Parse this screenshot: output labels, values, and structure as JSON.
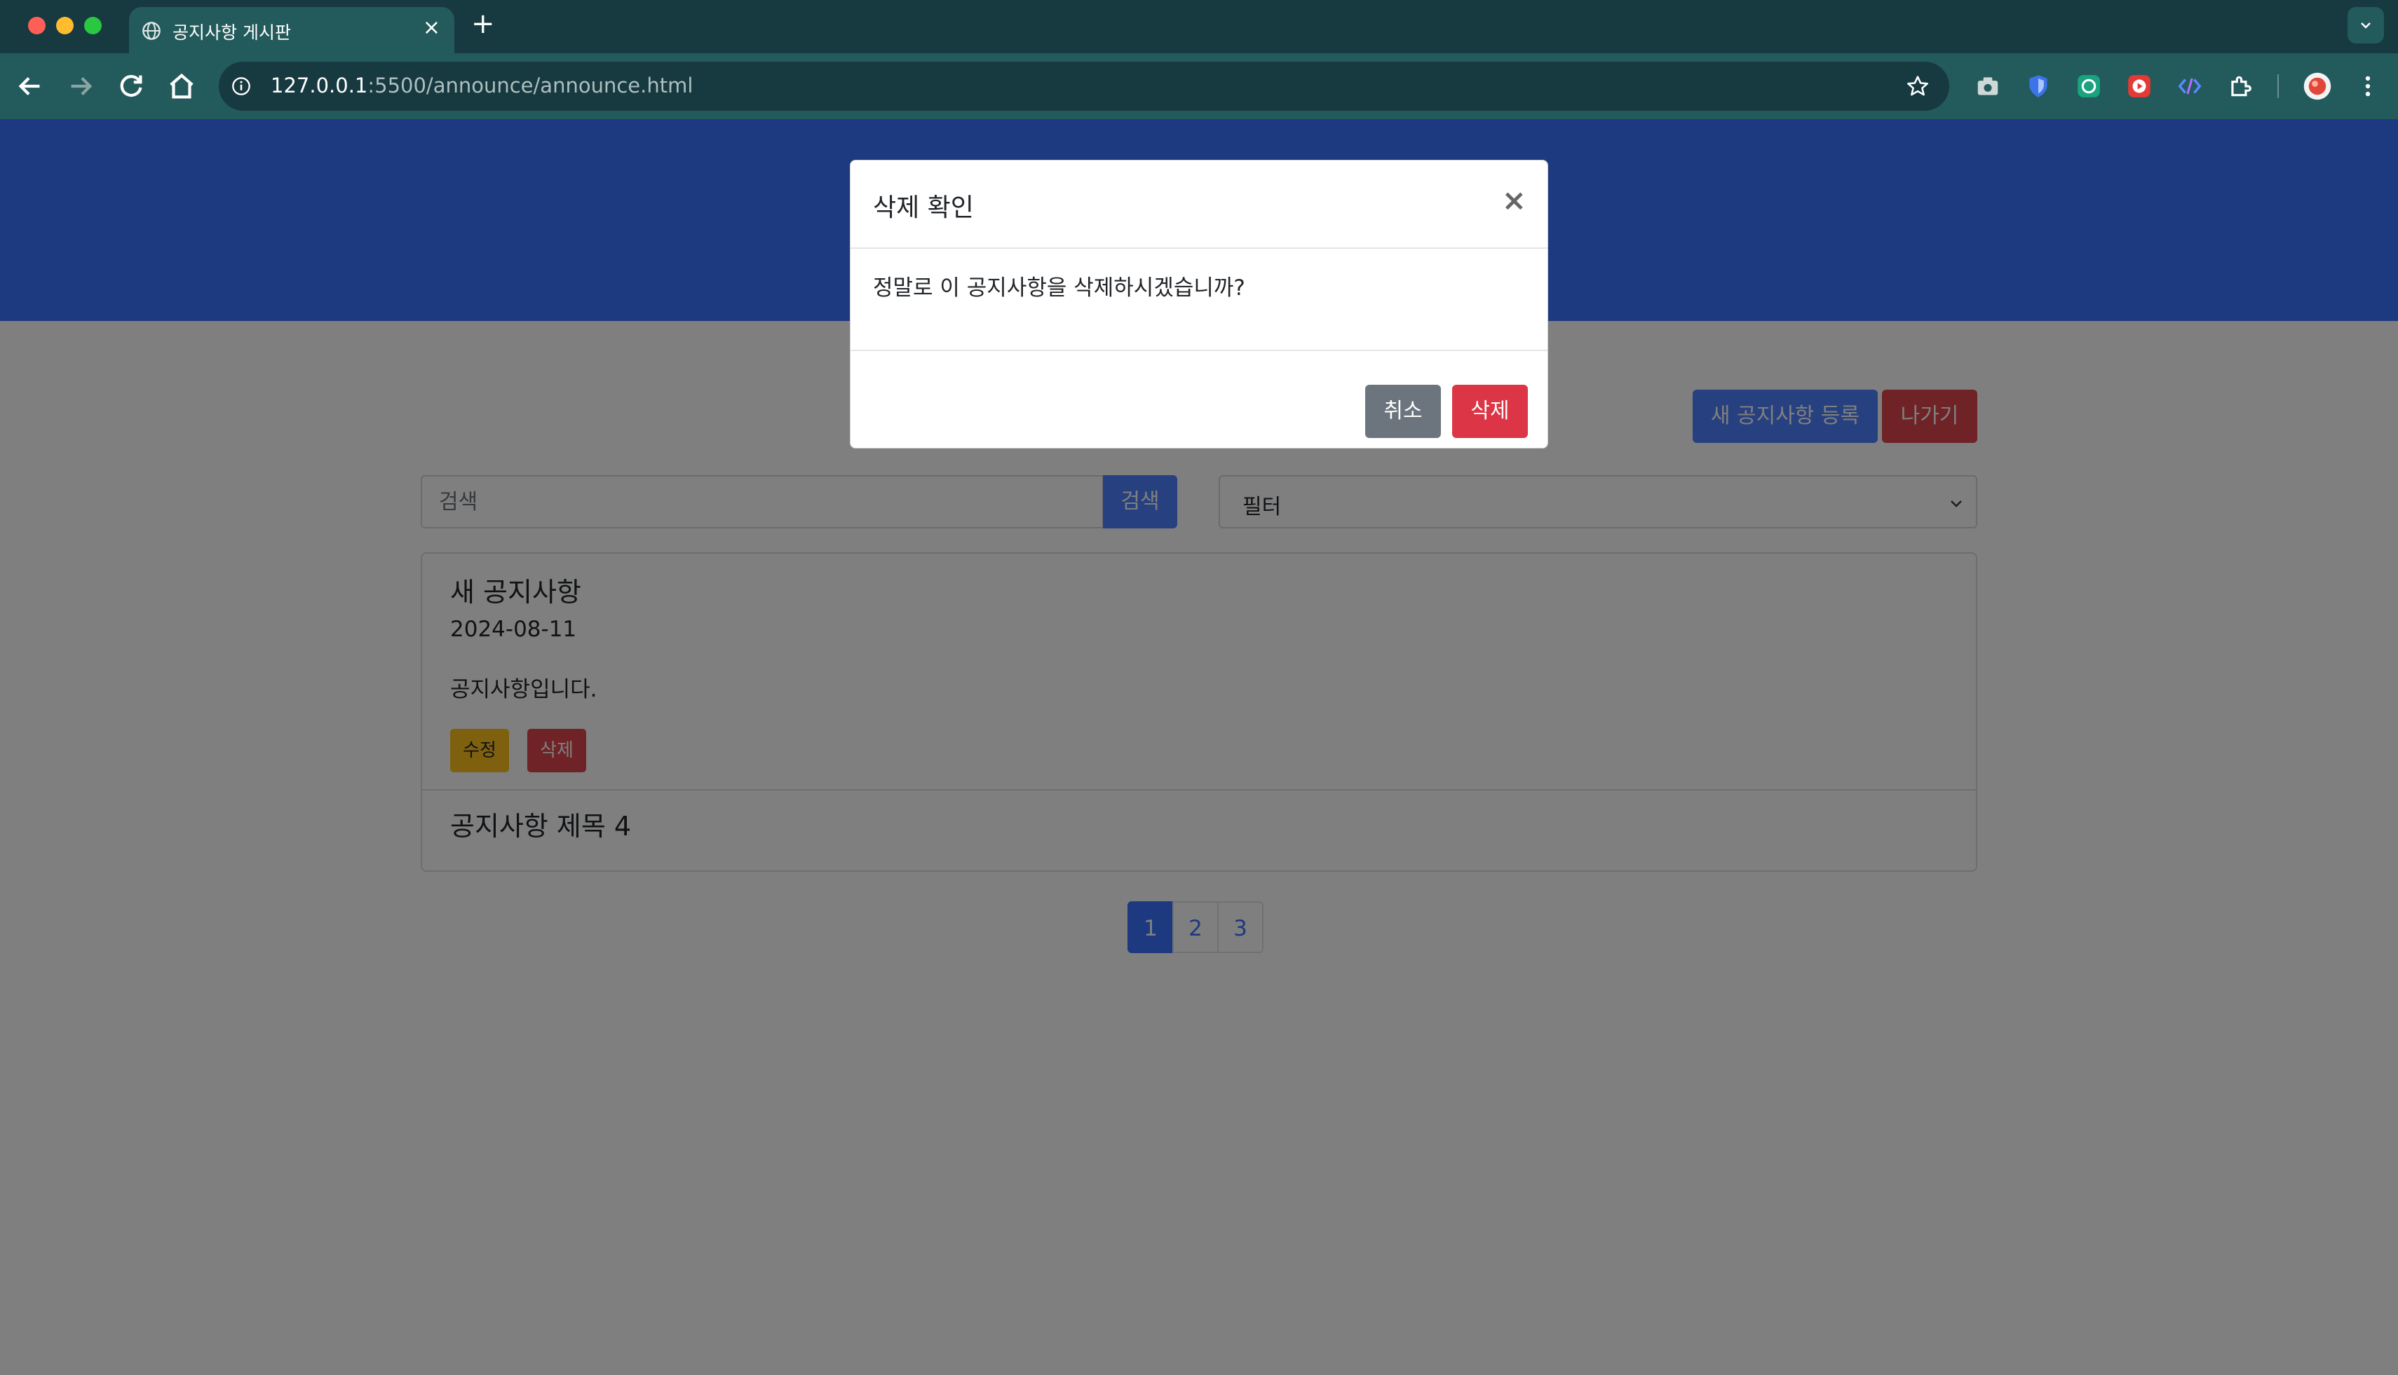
{
  "browser": {
    "tab_title": "공지사항 게시판",
    "url_host": "127.0.0.1",
    "url_rest": ":5500/announce/announce.html"
  },
  "toolbar_icons": [
    "back-icon",
    "forward-icon",
    "reload-icon",
    "home-icon",
    "site-info-icon",
    "bookmark-star-icon",
    "camera-extension-icon",
    "shield-extension-icon",
    "chatgpt-extension-icon",
    "video-extension-icon",
    "code-extension-icon",
    "puzzle-extension-icon",
    "profile-avatar",
    "kebab-menu-icon"
  ],
  "header_buttons": {
    "new_label": "새 공지사항 등록",
    "exit_label": "나가기"
  },
  "search": {
    "placeholder": "검색",
    "button_label": "검색"
  },
  "filter": {
    "selected": "필터"
  },
  "announcements": [
    {
      "title": "새 공지사항",
      "date": "2024-08-11",
      "content": "공지사항입니다.",
      "edit_label": "수정",
      "delete_label": "삭제"
    },
    {
      "title": "공지사항 제목 4"
    }
  ],
  "pagination": {
    "pages": [
      "1",
      "2",
      "3"
    ],
    "active": "1"
  },
  "modal": {
    "title": "삭제 확인",
    "close_label": "×",
    "message": "정말로 이 공지사항을 삭제하시겠습니까?",
    "cancel_label": "취소",
    "confirm_label": "삭제"
  },
  "colors": {
    "chrome_dark": "#173940",
    "chrome_tab": "#235a5b",
    "banner": "#3a73ff",
    "primary": "#4f80ff",
    "danger": "#e0464f",
    "warning": "#ffc11c",
    "secondary": "#6c757d",
    "backdrop": "rgba(0,0,0,0.5)"
  }
}
